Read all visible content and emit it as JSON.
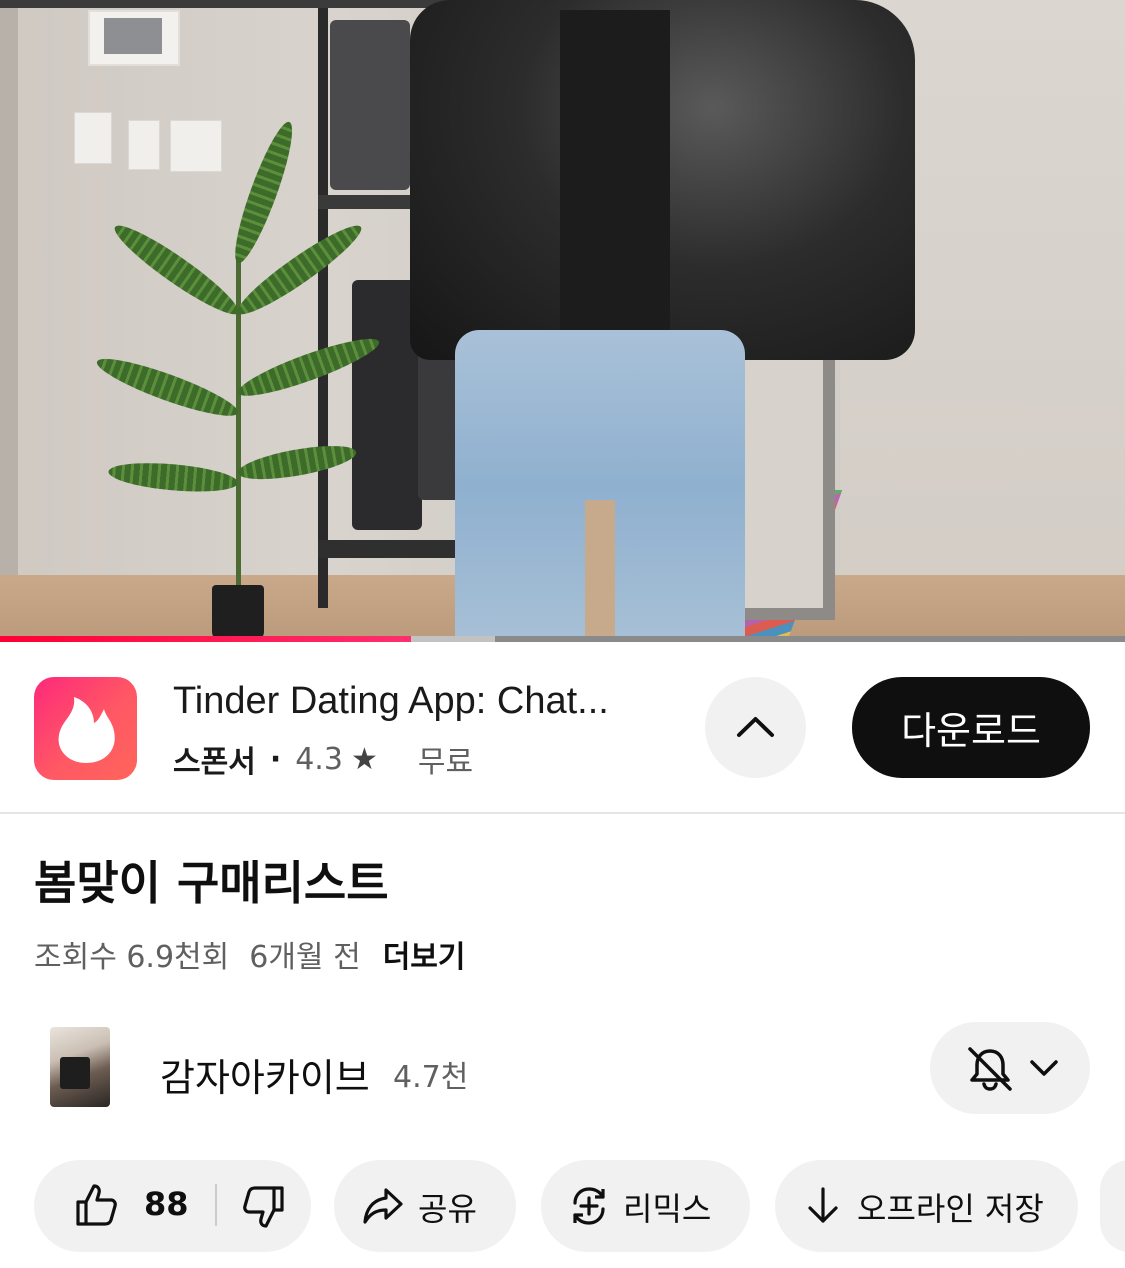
{
  "video": {
    "progress_fraction": 0.365,
    "buffer_fraction": 0.44,
    "colors": {
      "progress": "#ff0033",
      "progress_end": "#ff2f6d",
      "track": "#8a8a8a"
    }
  },
  "ad": {
    "app_title": "Tinder Dating App: Chat...",
    "sponsor_label": "스폰서",
    "separator": "·",
    "rating": "4.3",
    "star": "★",
    "price": "무료",
    "download_label": "다운로드",
    "icons": {
      "app": "tinder-flame-icon",
      "collapse": "chevron-up-icon"
    },
    "colors": {
      "app_icon_start": "#fd297b",
      "app_icon_end": "#ff655b"
    }
  },
  "video_info": {
    "title": "봄맞이 구매리스트",
    "views": "조회수 6.9천회",
    "age": "6개월 전",
    "more_label": "더보기"
  },
  "channel": {
    "name": "감자아카이브",
    "subscribers": "4.7천",
    "icons": {
      "notifications": "bell-off-icon",
      "dropdown": "chevron-down-icon"
    }
  },
  "actions": {
    "like_count": "88",
    "share_label": "공유",
    "remix_label": "리믹스",
    "download_label": "오프라인 저장",
    "icons": {
      "like": "thumbs-up-icon",
      "dislike": "thumbs-down-icon",
      "share": "share-arrow-icon",
      "remix": "remix-icon",
      "download": "download-arrow-icon"
    }
  }
}
